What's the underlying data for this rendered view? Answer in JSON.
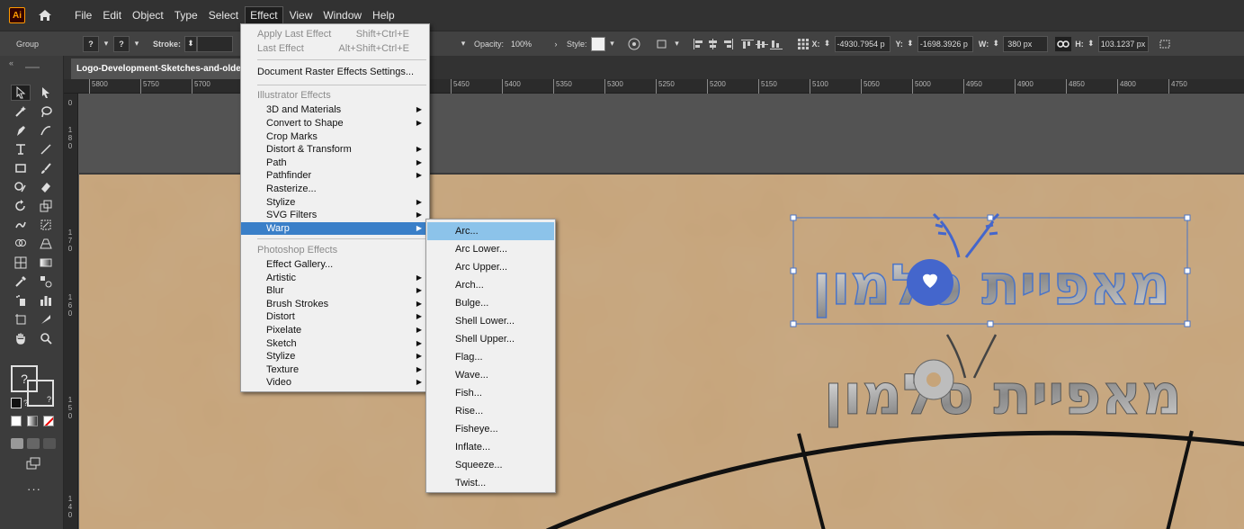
{
  "app": {
    "logo": "Ai",
    "accent": "#ff9a00"
  },
  "menubar": {
    "items": [
      "File",
      "Edit",
      "Object",
      "Type",
      "Select",
      "Effect",
      "View",
      "Window",
      "Help"
    ],
    "active": "Effect"
  },
  "controlbar": {
    "selection_label": "Group",
    "stroke_label": "Stroke:",
    "opacity_label": "Opacity:",
    "opacity_value": "100%",
    "style_label": "Style:",
    "x_label": "X:",
    "x_value": "-4930.7954 p",
    "y_label": "Y:",
    "y_value": "-1698.3926 p",
    "w_label": "W:",
    "w_value": "380 px",
    "h_label": "H:",
    "h_value": "103.1237 px"
  },
  "document": {
    "tab_label": "Logo-Development-Sketches-and-older"
  },
  "rulers": {
    "horizontal": [
      "5800",
      "5750",
      "5700",
      "5450",
      "5400",
      "5350",
      "5300",
      "5250",
      "5200",
      "5150",
      "5100",
      "5050",
      "5000",
      "4950",
      "4900",
      "4850",
      "4800",
      "4750"
    ],
    "vertical": [
      "0",
      "1 8 0",
      "1 7 0",
      "1 6 0",
      "1 5 0",
      "1 4 0"
    ]
  },
  "effect_menu": {
    "apply_last": "Apply Last Effect",
    "apply_last_shortcut": "Shift+Ctrl+E",
    "last_effect": "Last Effect",
    "last_effect_shortcut": "Alt+Shift+Ctrl+E",
    "doc_raster": "Document Raster Effects Settings...",
    "illustrator_header": "Illustrator Effects",
    "illustrator_items": [
      "3D and Materials",
      "Convert to Shape",
      "Crop Marks",
      "Distort & Transform",
      "Path",
      "Pathfinder",
      "Rasterize...",
      "Stylize",
      "SVG Filters",
      "Warp"
    ],
    "photoshop_header": "Photoshop Effects",
    "photoshop_items": [
      "Effect Gallery...",
      "Artistic",
      "Blur",
      "Brush Strokes",
      "Distort",
      "Pixelate",
      "Sketch",
      "Stylize",
      "Texture",
      "Video"
    ],
    "highlighted": "Warp",
    "highlight_color": "#3a7fc8"
  },
  "warp_menu": {
    "items": [
      "Arc...",
      "Arc Lower...",
      "Arc Upper...",
      "Arch...",
      "Bulge...",
      "Shell Lower...",
      "Shell Upper...",
      "Flag...",
      "Wave...",
      "Fish...",
      "Rise...",
      "Fisheye...",
      "Inflate...",
      "Squeeze...",
      "Twist..."
    ],
    "highlighted": "Arc...",
    "highlight_color": "#8cc3ea"
  },
  "artwork": {
    "logo_text": "מאפיית סלמון"
  }
}
